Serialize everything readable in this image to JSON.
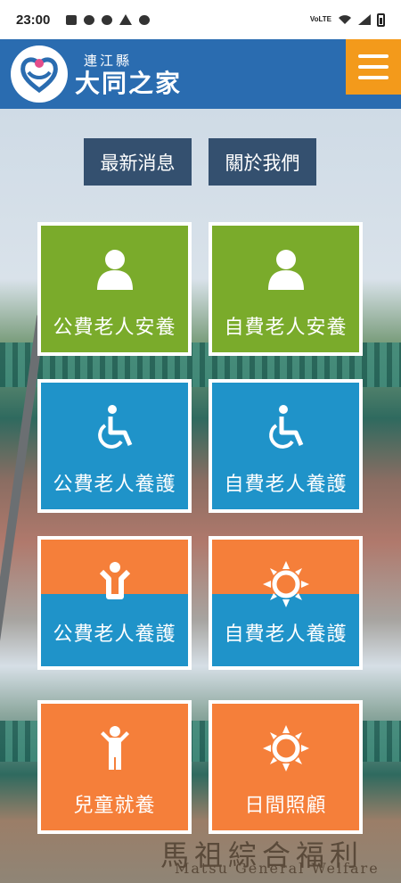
{
  "status_bar": {
    "time": "23:00",
    "network": "VoLTE",
    "icons": [
      "message-icon",
      "messenger-icon",
      "line-icon",
      "warning-icon",
      "tiktok-icon",
      "wifi-icon",
      "signal-icon",
      "battery-icon"
    ]
  },
  "header": {
    "county": "連江縣",
    "site_name": "大同之家",
    "menu_icon": "hamburger-menu-icon",
    "brand_color": "#2a6cb0",
    "menu_color": "#f39a1b"
  },
  "nav_buttons": [
    {
      "label": "最新消息"
    },
    {
      "label": "關於我們"
    }
  ],
  "tiles": [
    {
      "label": "公費老人安養",
      "icon": "person-icon",
      "color": "#7aab2b"
    },
    {
      "label": "自費老人安養",
      "icon": "person-icon",
      "color": "#7aab2b"
    },
    {
      "label": "公費老人養護",
      "icon": "wheelchair-icon",
      "color": "#1f93c9"
    },
    {
      "label": "自費老人養護",
      "icon": "wheelchair-icon",
      "color": "#1f93c9"
    },
    {
      "label": "公費老人養護",
      "icon": "child-wheelchair-overlap-icon",
      "color": "#1f93c9"
    },
    {
      "label": "自費老人養護",
      "icon": "sun-wheelchair-overlap-icon",
      "color": "#1f93c9"
    },
    {
      "label": "兒童就養",
      "icon": "child-icon",
      "color": "#f57f3a"
    },
    {
      "label": "日間照顧",
      "icon": "sun-icon",
      "color": "#f57f3a"
    }
  ],
  "background_sign": {
    "chinese": "馬祖綜合福利",
    "english": "Matsu General Welfare"
  }
}
